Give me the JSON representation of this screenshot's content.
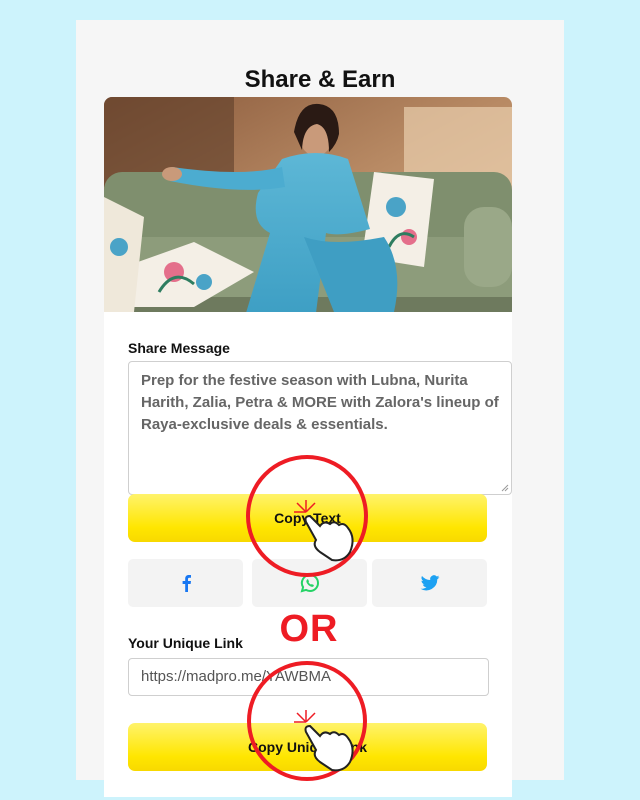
{
  "page": {
    "title": "Share & Earn",
    "hero_image": "woman-in-blue-dress-on-sofa"
  },
  "share_message": {
    "label": "Share Message",
    "text": "Prep for the festive season with Lubna, Nurita Harith, Zalia, Petra & MORE with Zalora's lineup of Raya-exclusive deals & essentials.",
    "copy_button": "Copy Text"
  },
  "social": [
    {
      "name": "facebook",
      "icon": "facebook-icon",
      "color": "#1877f2"
    },
    {
      "name": "whatsapp",
      "icon": "whatsapp-icon",
      "color": "#25d366"
    },
    {
      "name": "twitter",
      "icon": "twitter-icon",
      "color": "#1da1f2"
    }
  ],
  "divider_text": "OR",
  "unique_link": {
    "label": "Your Unique Link",
    "url": "https://madpro.me/YAWBMA",
    "copy_button": "Copy Unique Link"
  },
  "colors": {
    "background": "#cdf3fc",
    "button_yellow": "#ffe600",
    "annotation_red": "#ee1c24"
  }
}
